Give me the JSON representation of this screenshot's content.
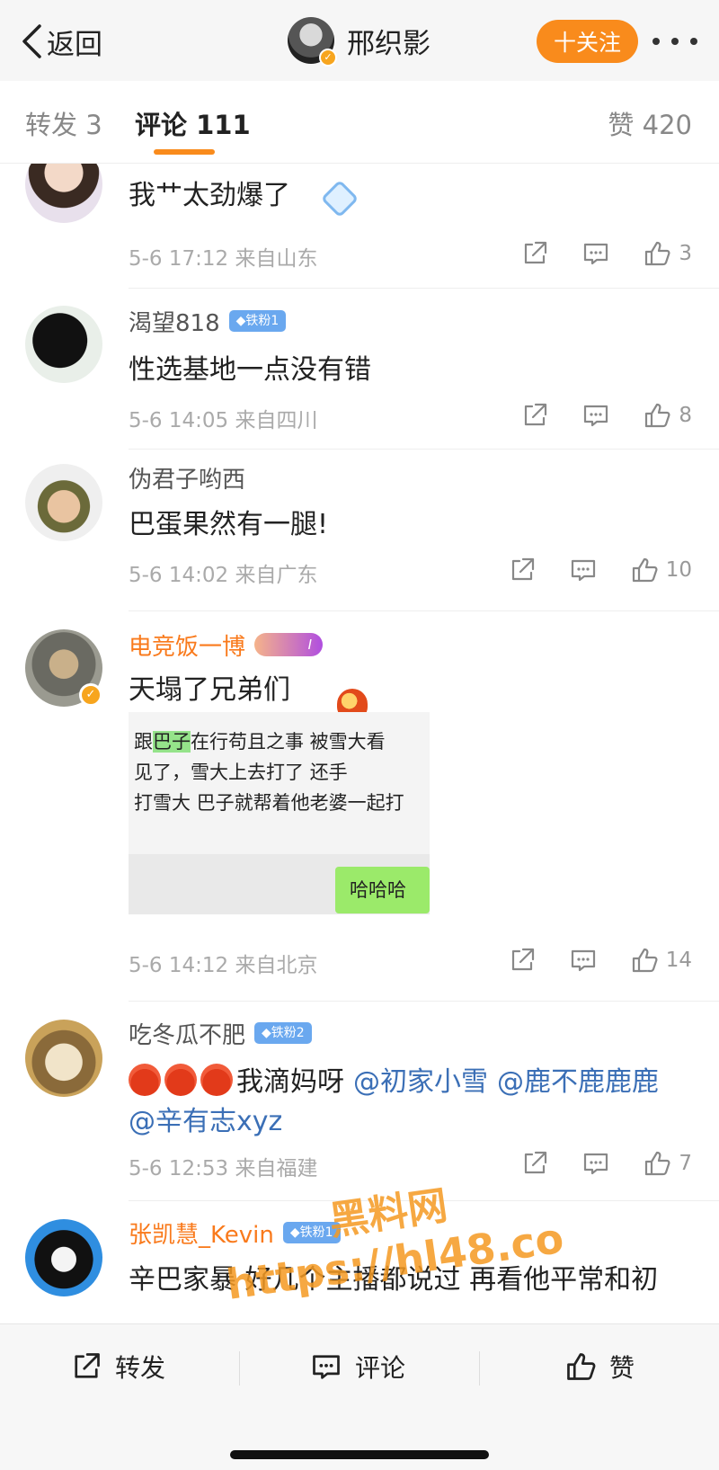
{
  "header": {
    "back_label": "返回",
    "profile_name": "邢织影",
    "follow_label": "十关注",
    "more_icon": "more-dots-icon"
  },
  "tabs": {
    "repost": "转发 3",
    "comment": "评论 111",
    "like": "赞 420"
  },
  "comments": [
    {
      "text": "我艹太劲爆了",
      "time": "5-6 17:12",
      "location": "来自山东",
      "likes": "3"
    },
    {
      "username": "渴望818",
      "badge": "◆铁粉1",
      "text": "性选基地一点没有错",
      "time": "5-6 14:05",
      "location": "来自四川",
      "likes": "8"
    },
    {
      "username": "伪君子哟西",
      "text": "巴蛋果然有一腿!",
      "time": "5-6 14:02",
      "location": "来自广东",
      "likes": "10"
    },
    {
      "username": "电竞饭一博",
      "badge": "I",
      "text": "天塌了兄弟们",
      "image": {
        "line1a": "跟",
        "line1hl": "巴子",
        "line1b": "在行苟且之事 被雪大看",
        "line2": "见了，雪大上去打了",
        "line2b": "还手",
        "line3": "打雪大 巴子就帮着他老婆一起打",
        "bubble": "哈哈哈"
      },
      "time": "5-6 14:12",
      "location": "来自北京",
      "likes": "14"
    },
    {
      "username": "吃冬瓜不肥",
      "badge": "◆铁粉2",
      "text": "我滴妈呀",
      "mention1": "@初家小雪",
      "mention2": "@鹿不鹿鹿鹿",
      "mention3": "@辛有志xyz",
      "time": "5-6 12:53",
      "location": "来自福建",
      "likes": "7"
    },
    {
      "username": "张凯慧_Kevin",
      "badge": "◆铁粉1",
      "text": "辛巴家暴 好几个主播都说过 再看他平常和初"
    }
  ],
  "watermark": {
    "line1": "黑料网",
    "line2": "https://hl48.co"
  },
  "bottom_bar": {
    "repost": "转发",
    "comment": "评论",
    "like": "赞"
  },
  "colors": {
    "accent": "#f98b1c",
    "mention": "#3b6fb6",
    "vip_name": "#f97a1c",
    "fan_badge": "#6aa8ef"
  }
}
